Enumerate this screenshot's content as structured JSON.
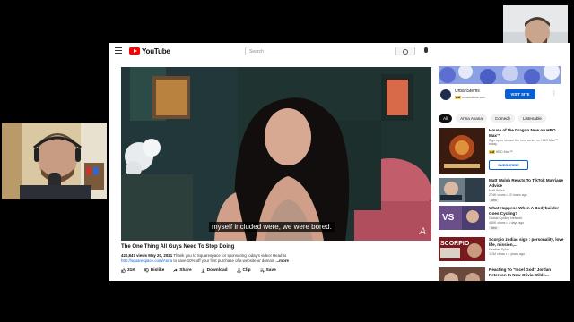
{
  "header": {
    "logo_text": "YouTube",
    "search_placeholder": "Search"
  },
  "video": {
    "subtitle": "myself included were, we were bored.",
    "watermark": "A",
    "title": "The One Thing All Guys Need To Stop Doing",
    "views": "420,847 views",
    "date": "May 20, 2021",
    "description": "Thank you to Squarespace for sponsoring today's video! Head to",
    "link": "http://squarespace.com/Anna",
    "description2": "to save 10% off your first purchase of a website or domain",
    "more": "...more",
    "actions": {
      "like": "31K",
      "dislike": "Dislike",
      "share": "Share",
      "download": "Download",
      "clip": "Clip",
      "save": "Save"
    }
  },
  "ad": {
    "name": "UrbanStems",
    "badge": "Ad",
    "url": "urbanstems.com",
    "visit_label": "VISIT SITE"
  },
  "chips": [
    "All",
    "Anna Akana",
    "Comedy",
    "Listenable"
  ],
  "recommendations": [
    {
      "title": "House of the Dragon Now on HBO Max™",
      "line1": "Sign up to stream the new series on HBO Max™ today.",
      "line2": "HBO Max™",
      "badge": "Ad",
      "button": "SUBSCRIBE"
    },
    {
      "title": "Matt Walsh Reacts To TikTok Marriage Advice",
      "line1": "Matt Walsh",
      "line2": "274K views • 22 hours ago",
      "badge": "New"
    },
    {
      "title": "What Happens When A Bodybuilder Goes Cycling?",
      "line1": "Global Cycling Network",
      "line2": "430K views • 3 days ago",
      "badge": "New"
    },
    {
      "title": "Scorpio zodiac sign : personality, love life, mission,...",
      "line1": "Heather Sylvia",
      "line2": "1.1M views • 4 years ago"
    },
    {
      "title": "Reacting To \"Incel God\" Jordan Peterson In New Olivia Wilde...",
      "line1": "",
      "line2": ""
    }
  ],
  "colors": {
    "brand_red": "#ff0000",
    "link_blue": "#065fd4"
  }
}
